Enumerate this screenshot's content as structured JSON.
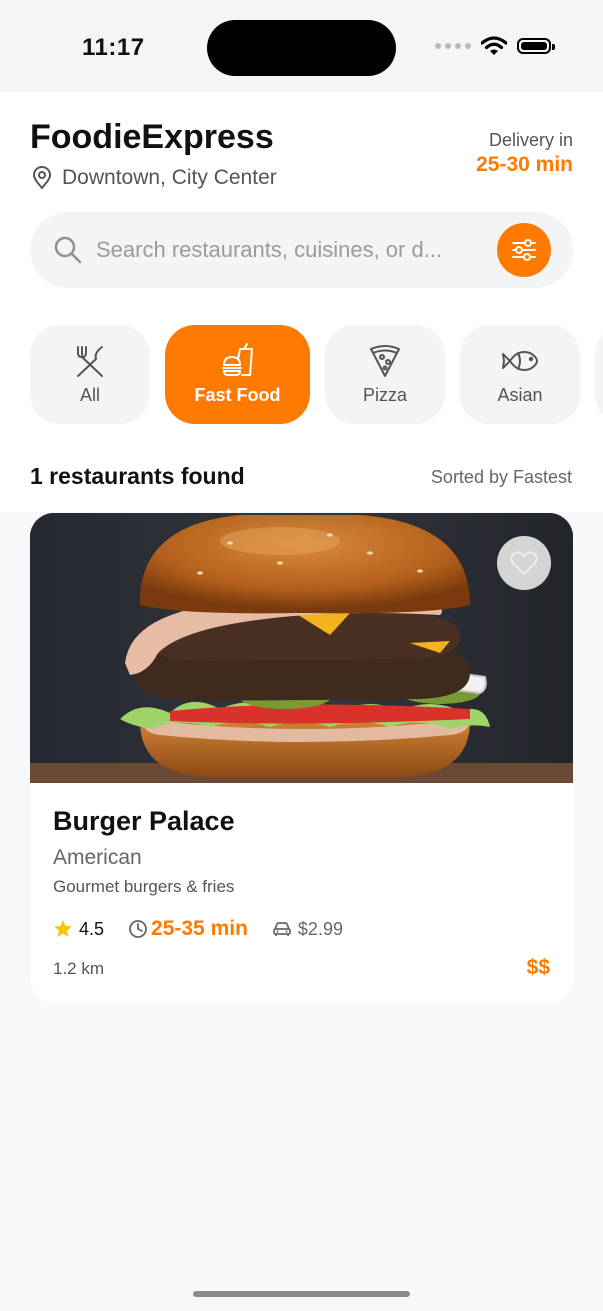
{
  "status_bar": {
    "time": "11:17"
  },
  "header": {
    "title": "FoodieExpress",
    "location": "Downtown, City Center",
    "delivery_label": "Delivery in",
    "delivery_value": "25-30 min"
  },
  "search": {
    "placeholder": "Search restaurants, cuisines, or d...",
    "value": ""
  },
  "categories": [
    {
      "label": "All",
      "icon": "utensils-icon",
      "active": false
    },
    {
      "label": "Fast Food",
      "icon": "burger-drink-icon",
      "active": true
    },
    {
      "label": "Pizza",
      "icon": "pizza-slice-icon",
      "active": false
    },
    {
      "label": "Asian",
      "icon": "fish-icon",
      "active": false
    }
  ],
  "results": {
    "count_text": "1 restaurants found",
    "sorted_text": "Sorted by Fastest"
  },
  "restaurant": {
    "name": "Burger Palace",
    "cuisine": "American",
    "description": "Gourmet burgers & fries",
    "rating": "4.5",
    "delivery_time": "25-35 min",
    "delivery_fee": "$2.99",
    "distance": "1.2 km",
    "price_level": "$$"
  },
  "colors": {
    "accent": "#ff7a00",
    "background": "#f7f8fa",
    "card": "#ffffff",
    "star": "#ffc400"
  }
}
